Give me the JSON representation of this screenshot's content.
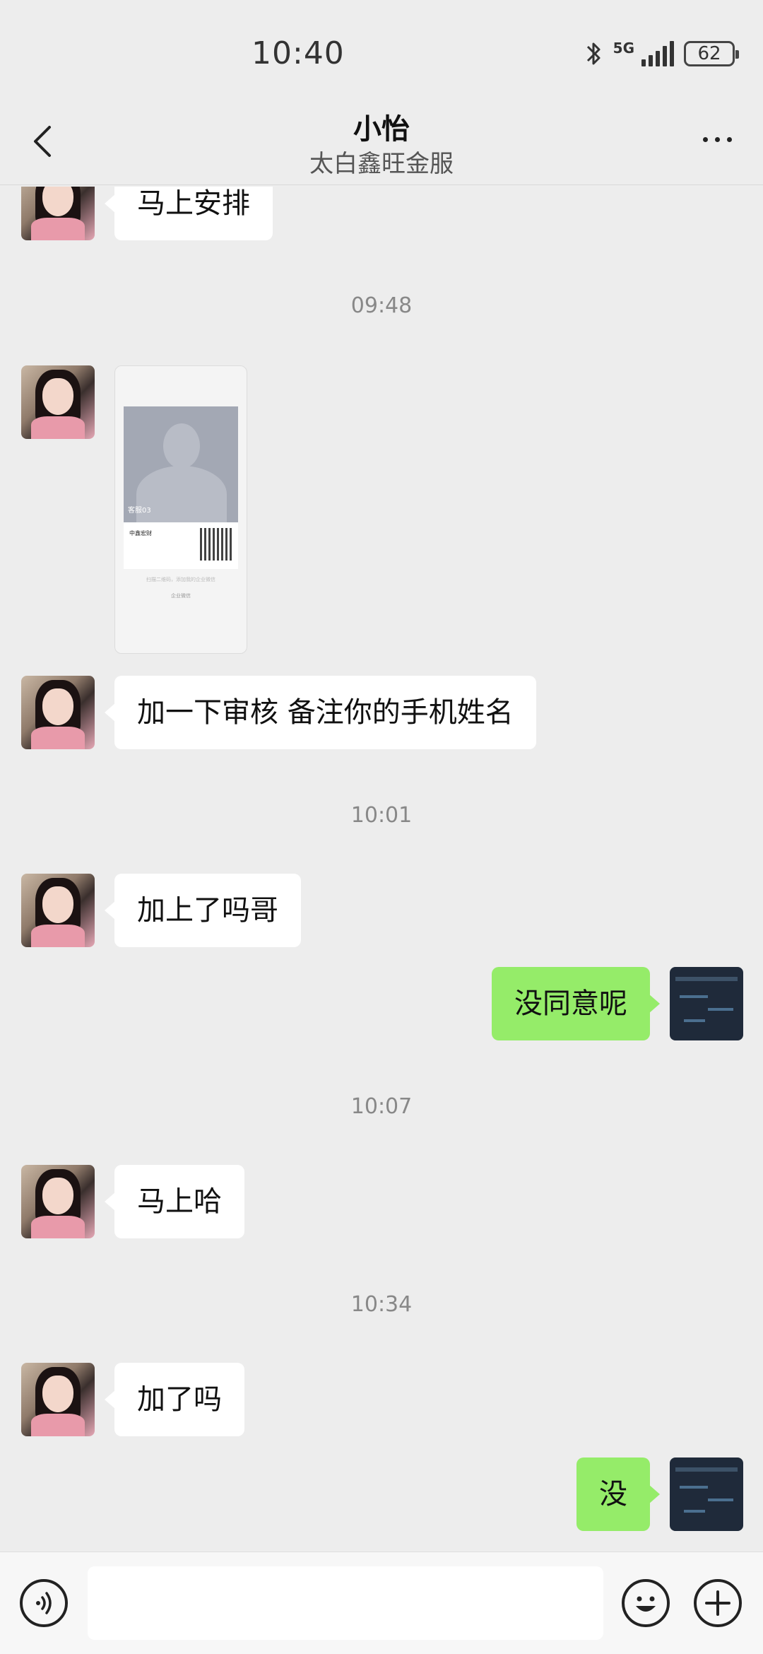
{
  "status_bar": {
    "time": "10:40",
    "network": "5G",
    "battery": "62",
    "icons": [
      "bluetooth-icon",
      "signal-icon",
      "battery-icon"
    ]
  },
  "header": {
    "title": "小怡",
    "subtitle": "太白鑫旺金服",
    "back_icon": "chevron-left-icon",
    "more_icon": "more-dots-icon"
  },
  "messages": [
    {
      "side": "left",
      "type": "text",
      "text": "马上安排"
    },
    {
      "type": "time",
      "text": "09:48"
    },
    {
      "side": "left",
      "type": "image",
      "card_label": "客服03",
      "card_name": "中鑫宏财",
      "card_hint": "扫描二维码，添加我的企业微信",
      "card_hint2": "企业微信"
    },
    {
      "side": "left",
      "type": "text",
      "text": "加一下审核 备注你的手机姓名"
    },
    {
      "type": "time",
      "text": "10:01"
    },
    {
      "side": "left",
      "type": "text",
      "text": "加上了吗哥"
    },
    {
      "side": "right",
      "type": "text",
      "text": "没同意呢"
    },
    {
      "type": "time",
      "text": "10:07"
    },
    {
      "side": "left",
      "type": "text",
      "text": "马上哈"
    },
    {
      "type": "time",
      "text": "10:34"
    },
    {
      "side": "left",
      "type": "text",
      "text": "加了吗"
    },
    {
      "side": "right",
      "type": "text",
      "text": "没"
    }
  ],
  "input_bar": {
    "voice_icon": "voice-icon",
    "emoji_icon": "emoji-icon",
    "plus_icon": "plus-icon",
    "input_value": ""
  },
  "colors": {
    "background": "#ededed",
    "own_bubble": "#95ec69",
    "other_bubble": "#ffffff"
  }
}
